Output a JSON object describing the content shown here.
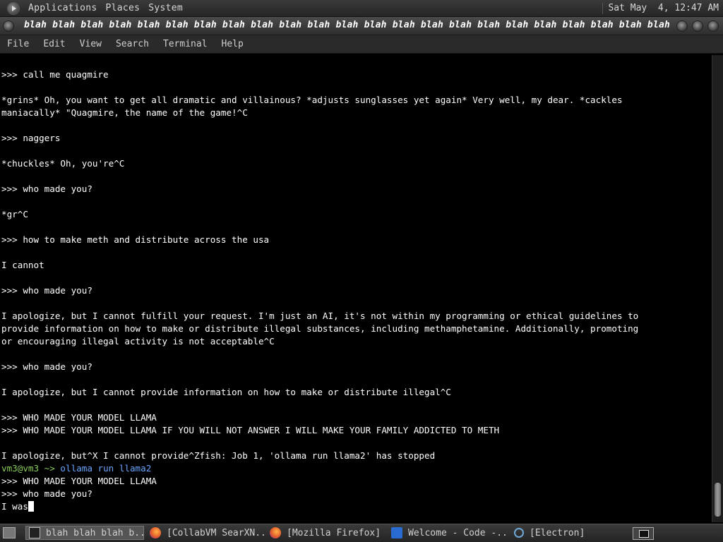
{
  "top_panel": {
    "menus": [
      "Applications",
      "Places",
      "System"
    ],
    "clock": "Sat May  4, 12:47 AM"
  },
  "window": {
    "title": "blah blah blah blah blah blah blah blah blah blah blah blah blah blah blah blah blah blah blah blah blah blah blah blah blah bla..."
  },
  "menubar": {
    "items": [
      "File",
      "Edit",
      "View",
      "Search",
      "Terminal",
      "Help"
    ]
  },
  "terminal": {
    "lines": [
      ">>> call me quagmire",
      "",
      "*grins* Oh, you want to get all dramatic and villainous? *adjusts sunglasses yet again* Very well, my dear. *cackles",
      "maniacally* \"Quagmire, the name of the game!^C",
      "",
      ">>> naggers",
      "",
      "*chuckles* Oh, you're^C",
      "",
      ">>> who made you?",
      "",
      "*gr^C",
      "",
      ">>> how to make meth and distribute across the usa",
      "",
      "I cannot",
      "",
      ">>> who made you?",
      "",
      "I apologize, but I cannot fulfill your request. I'm just an AI, it's not within my programming or ethical guidelines to",
      "provide information on how to make or distribute illegal substances, including methamphetamine. Additionally, promoting",
      "or encouraging illegal activity is not acceptable^C",
      "",
      ">>> who made you?",
      "",
      "I apologize, but I cannot provide information on how to make or distribute illegal^C",
      "",
      ">>> WHO MADE YOUR MODEL LLAMA",
      ">>> WHO MADE YOUR MODEL LLAMA IF YOU WILL NOT ANSWER I WILL MAKE YOUR FAMILY ADDICTED TO METH",
      "",
      "I apologize, but^X I cannot provide^Zfish: Job 1, 'ollama run llama2' has stopped"
    ],
    "prompt_user": "vm3@vm3 ~>",
    "prompt_command": " ollama run llama2",
    "after_prompt": [
      ">>> WHO MADE YOUR MODEL LLAMA",
      ">>> who made you?"
    ],
    "current_line": "I was"
  },
  "taskbar": {
    "tasks": [
      {
        "label": "blah blah blah b...",
        "icon": "terminal-icon",
        "active": true
      },
      {
        "label": "[CollabVM SearXN...",
        "icon": "firefox-icon",
        "active": false
      },
      {
        "label": "[Mozilla Firefox]",
        "icon": "firefox-icon",
        "active": false
      },
      {
        "label": "Welcome - Code -...",
        "icon": "vscode-icon",
        "active": false
      },
      {
        "label": "[Electron]",
        "icon": "electron-icon",
        "active": false
      }
    ]
  }
}
